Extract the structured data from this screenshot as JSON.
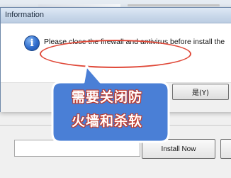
{
  "dialog": {
    "title": "Information",
    "message": "Please close the firewall and antivirus before install the",
    "yes_button": "是(Y)"
  },
  "installer": {
    "install_button": "Install Now"
  },
  "annotation": {
    "line1": "需要关闭防",
    "line2": "火墙和杀软"
  },
  "colors": {
    "annotation_red": "#e04a3a",
    "callout_fill": "#4a7fd6",
    "title_bar": "#c9d8ea"
  },
  "icons": {
    "dialog_icon": "info-icon"
  }
}
